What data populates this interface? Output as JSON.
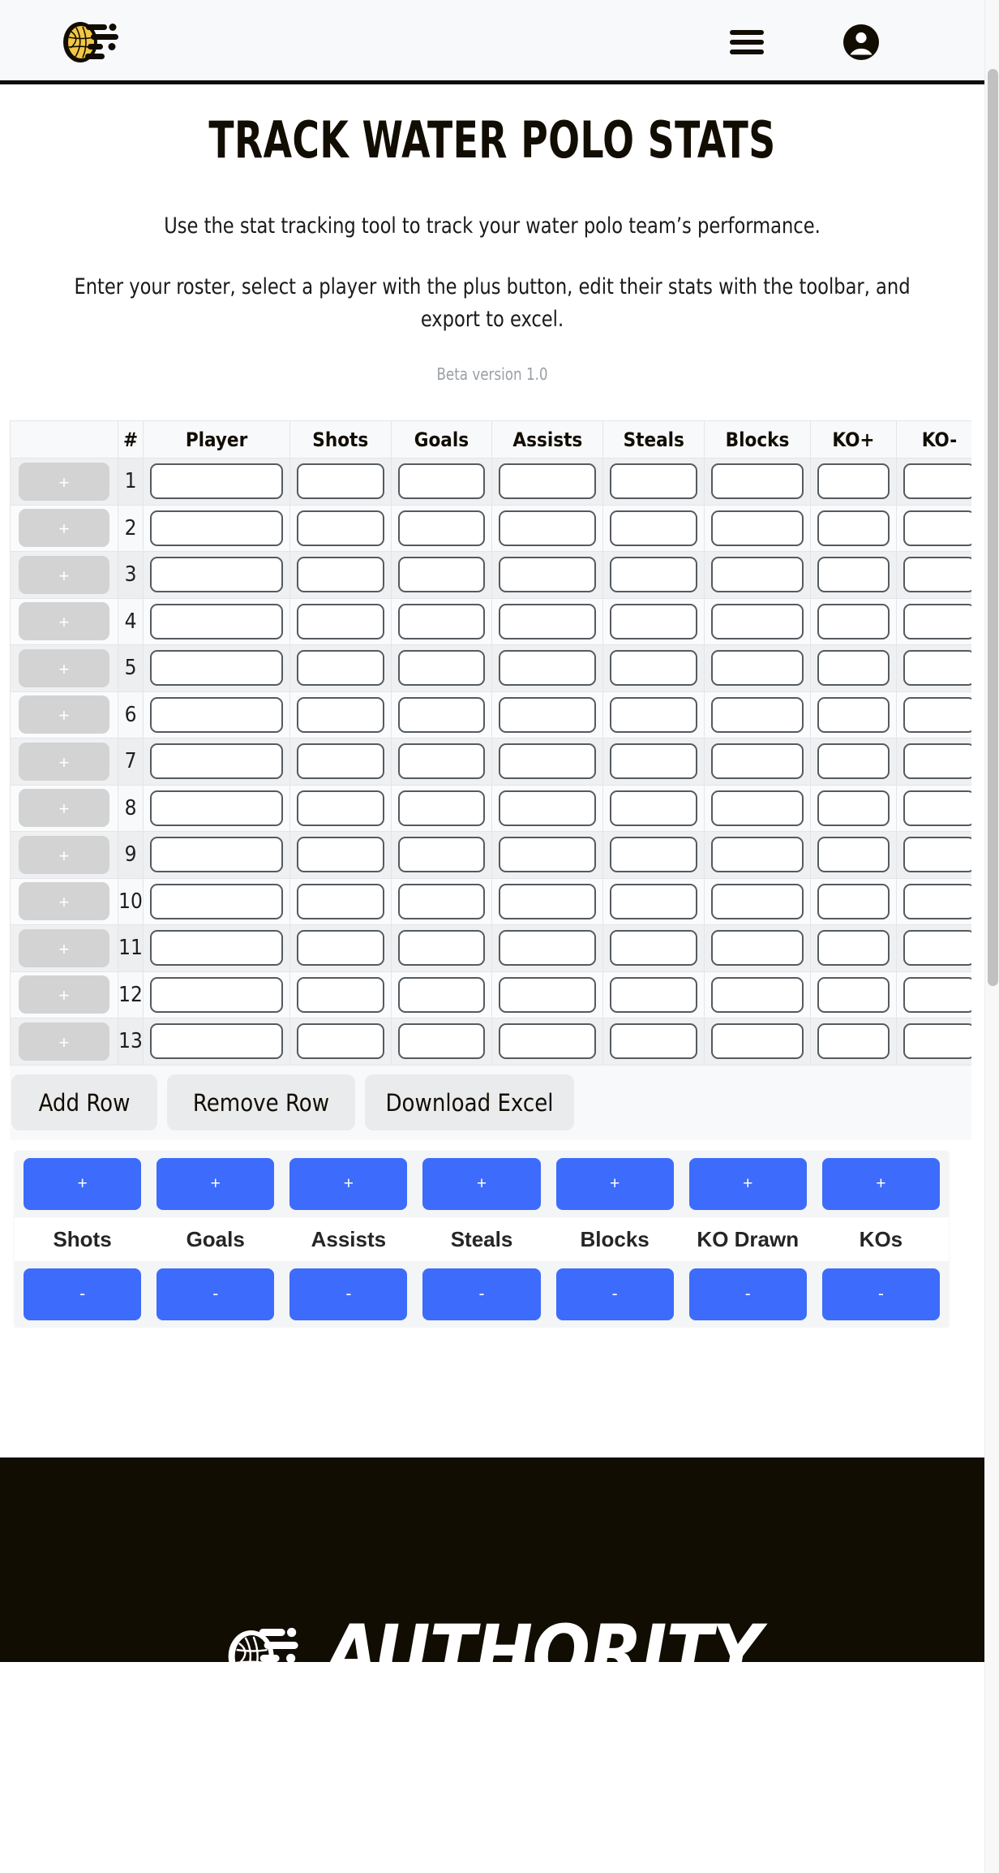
{
  "header": {
    "logo_icon": "waterpolo-ball-motion-logo",
    "menu_icon": "hamburger-menu-icon",
    "account_icon": "account-circle-icon"
  },
  "hero": {
    "title": "TRACK WATER POLO STATS",
    "lead1": "Use the stat tracking tool to track your water polo team’s performance.",
    "lead2": "Enter your roster, select a player with the plus button, edit their stats with the toolbar, and export to excel.",
    "beta": "Beta version 1.0"
  },
  "table": {
    "columns": [
      "",
      "#",
      "Player",
      "Shots",
      "Goals",
      "Assists",
      "Steals",
      "Blocks",
      "KO+",
      "KO-"
    ],
    "select_label": "+",
    "rows": [
      {
        "n": "1",
        "player": "",
        "shots": "",
        "goals": "",
        "assists": "",
        "steals": "",
        "blocks": "",
        "kop": "",
        "kom": ""
      },
      {
        "n": "2",
        "player": "",
        "shots": "",
        "goals": "",
        "assists": "",
        "steals": "",
        "blocks": "",
        "kop": "",
        "kom": ""
      },
      {
        "n": "3",
        "player": "",
        "shots": "",
        "goals": "",
        "assists": "",
        "steals": "",
        "blocks": "",
        "kop": "",
        "kom": ""
      },
      {
        "n": "4",
        "player": "",
        "shots": "",
        "goals": "",
        "assists": "",
        "steals": "",
        "blocks": "",
        "kop": "",
        "kom": ""
      },
      {
        "n": "5",
        "player": "",
        "shots": "",
        "goals": "",
        "assists": "",
        "steals": "",
        "blocks": "",
        "kop": "",
        "kom": ""
      },
      {
        "n": "6",
        "player": "",
        "shots": "",
        "goals": "",
        "assists": "",
        "steals": "",
        "blocks": "",
        "kop": "",
        "kom": ""
      },
      {
        "n": "7",
        "player": "",
        "shots": "",
        "goals": "",
        "assists": "",
        "steals": "",
        "blocks": "",
        "kop": "",
        "kom": ""
      },
      {
        "n": "8",
        "player": "",
        "shots": "",
        "goals": "",
        "assists": "",
        "steals": "",
        "blocks": "",
        "kop": "",
        "kom": ""
      },
      {
        "n": "9",
        "player": "",
        "shots": "",
        "goals": "",
        "assists": "",
        "steals": "",
        "blocks": "",
        "kop": "",
        "kom": ""
      },
      {
        "n": "10",
        "player": "",
        "shots": "",
        "goals": "",
        "assists": "",
        "steals": "",
        "blocks": "",
        "kop": "",
        "kom": ""
      },
      {
        "n": "11",
        "player": "",
        "shots": "",
        "goals": "",
        "assists": "",
        "steals": "",
        "blocks": "",
        "kop": "",
        "kom": ""
      },
      {
        "n": "12",
        "player": "",
        "shots": "",
        "goals": "",
        "assists": "",
        "steals": "",
        "blocks": "",
        "kop": "",
        "kom": ""
      },
      {
        "n": "13",
        "player": "",
        "shots": "",
        "goals": "",
        "assists": "",
        "steals": "",
        "blocks": "",
        "kop": "",
        "kom": ""
      }
    ]
  },
  "actions": {
    "add_row": "Add Row",
    "remove_row": "Remove Row",
    "download_excel": "Download Excel"
  },
  "toolbar": {
    "increment_label": "+",
    "decrement_label": "-",
    "stats": [
      "Shots",
      "Goals",
      "Assists",
      "Steals",
      "Blocks",
      "KO Drawn",
      "KOs"
    ],
    "accent_color": "#3d6bfb"
  },
  "footer": {
    "wordmark": "AUTHORITY",
    "logo_icon": "waterpolo-ball-motion-logo",
    "background_color": "#120d03"
  }
}
